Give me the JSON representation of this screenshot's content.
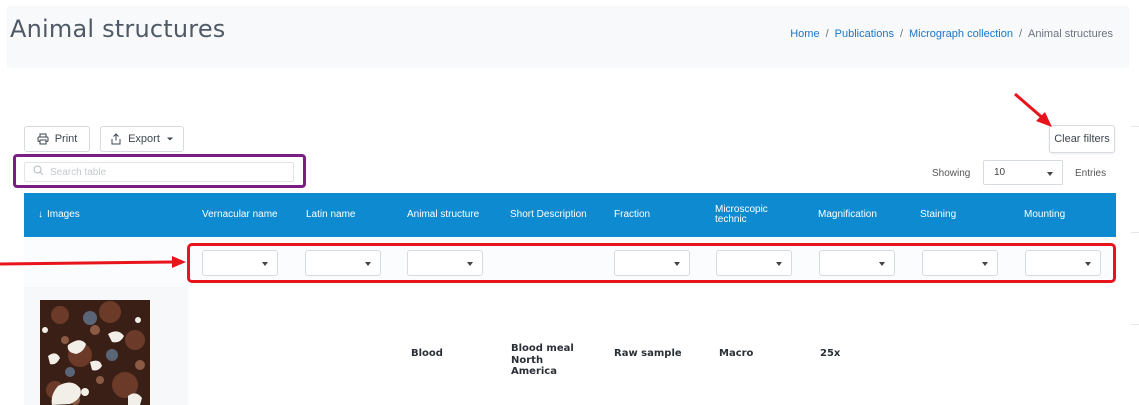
{
  "header": {
    "title": "Animal structures",
    "breadcrumb": {
      "items": [
        "Home",
        "Publications",
        "Micrograph collection"
      ],
      "separator": "/",
      "current": "Animal structures"
    }
  },
  "toolbar": {
    "print_label": "Print",
    "export_label": "Export",
    "clear_filters_label": "Clear filters"
  },
  "search": {
    "placeholder": "Search table",
    "value": ""
  },
  "pagination": {
    "showing_label": "Showing",
    "entries_value": "10",
    "entries_label": "Entries"
  },
  "table": {
    "columns": [
      "Images",
      "Vernacular name",
      "Latin name",
      "Animal structure",
      "Short Description",
      "Fraction",
      "Microscopic technic",
      "Magnification",
      "Staining",
      "Mounting"
    ],
    "sort_indicator": "↓",
    "rows": [
      {
        "vernacular_name": "",
        "latin_name": "",
        "animal_structure": "Blood",
        "short_description": "Blood meal North America",
        "fraction": "Raw sample",
        "microscopic_technic": "Macro",
        "magnification": "25x",
        "staining": "",
        "mounting": ""
      }
    ]
  },
  "colors": {
    "header_blue": "#0e8ad0",
    "link_blue": "#1877c9",
    "annotation_red": "#e8141b",
    "annotation_purple": "#7b1e83"
  },
  "icons": [
    "printer-icon",
    "share-icon",
    "caret-down-icon",
    "search-icon",
    "sort-down-icon"
  ]
}
